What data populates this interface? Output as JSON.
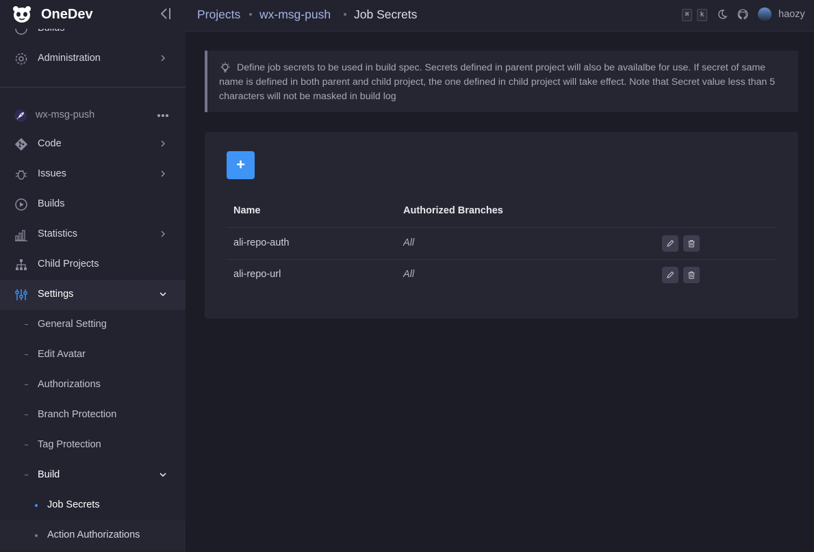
{
  "app": {
    "name": "OneDev"
  },
  "sidebar": {
    "partial_item": "Builds",
    "administration": "Administration",
    "project_name": "wx-msg-push",
    "items": [
      {
        "label": "Code"
      },
      {
        "label": "Issues"
      },
      {
        "label": "Builds"
      },
      {
        "label": "Statistics"
      },
      {
        "label": "Child Projects"
      },
      {
        "label": "Settings"
      }
    ],
    "settings_items": [
      {
        "label": "General Setting"
      },
      {
        "label": "Edit Avatar"
      },
      {
        "label": "Authorizations"
      },
      {
        "label": "Branch Protection"
      },
      {
        "label": "Tag Protection"
      },
      {
        "label": "Build"
      }
    ],
    "build_items": [
      {
        "label": "Job Secrets"
      },
      {
        "label": "Action Authorizations"
      }
    ]
  },
  "breadcrumb": {
    "projects": "Projects",
    "project": "wx-msg-push",
    "current": "Job Secrets"
  },
  "topbar": {
    "shortcut_key1": "⌘",
    "shortcut_key2": "k",
    "username": "haozy"
  },
  "alert": {
    "text": "Define job secrets to be used in build spec. Secrets defined in parent project will also be availalbe for use. If secret of same name is defined in both parent and child project, the one defined in child project will take effect. Note that Secret value less than 5 characters will not be masked in build log"
  },
  "table": {
    "add_label": "+",
    "headers": {
      "name": "Name",
      "branches": "Authorized Branches"
    },
    "rows": [
      {
        "name": "ali-repo-auth",
        "branches": "All"
      },
      {
        "name": "ali-repo-url",
        "branches": "All"
      }
    ]
  },
  "colors": {
    "accent": "#3e95f5",
    "background": "#1c1c27",
    "panel": "#262633"
  }
}
